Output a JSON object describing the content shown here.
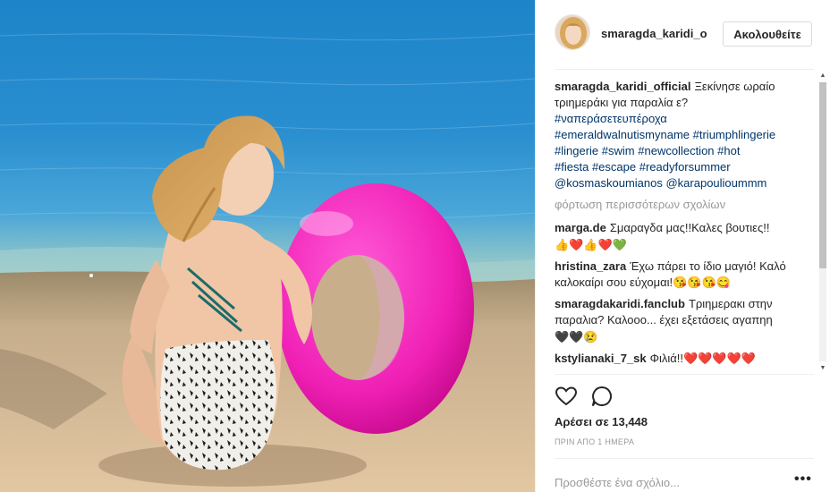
{
  "post": {
    "username": "smaragda_karidi_o",
    "follow_label": "Ακολουθείτε",
    "caption_user": "smaragda_karidi_official",
    "caption_text": "Ξεκίνησε ωραίο τριημεράκι για παραλία ε?",
    "hashtags": [
      "#ναπεράσετευπέροχα",
      "#emeraldwalnutismyname",
      "#triumphlingerie",
      "#lingerie",
      "#swim",
      "#newcollection",
      "#hot",
      "#fiesta",
      "#escape",
      "#readyforsummer"
    ],
    "mentions": [
      "@kosmaskoumianos",
      "@karapoulioummm"
    ],
    "load_more": "φόρτωση περισσότερων σχολίων",
    "likes": "Αρέσει σε 13,448",
    "time": "ΠΡΙΝ ΑΠΟ 1 ΗΜΕΡΑ",
    "comment_placeholder": "Προσθέστε ένα σχόλιο...",
    "options_label": "•••"
  },
  "comments": [
    {
      "user": "marga.de",
      "text": "Σμαραγδα μας!!Καλες βουτιες!!",
      "emoji": "👍❤️👍❤️💚"
    },
    {
      "user": "hristina_zara",
      "text": "Έχω πάρει το ίδιο μαγιό! Καλό καλοκαίρι σου εύχομαι!",
      "emoji": "😘😘😘😋"
    },
    {
      "user": "smaragdakaridi.fanclub",
      "text": "Τριημερακι στην παραλια? Καλοοο... έχει εξετάσεις αγαπηη",
      "emoji": "🖤🖤😢"
    },
    {
      "user": "kstylianaki_7_sk",
      "text": "Φιλιά!!",
      "emoji": "❤️❤️❤️❤️❤️"
    }
  ],
  "icons": {
    "heart": "heart-icon",
    "comment": "comment-bubble-icon",
    "options": "more-options-icon"
  },
  "colors": {
    "link": "#003569",
    "muted": "#999999",
    "text": "#262626",
    "border": "#efefef"
  }
}
